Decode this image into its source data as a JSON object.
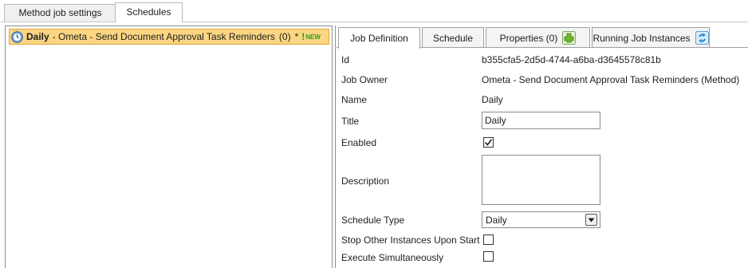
{
  "outer_tabs": [
    {
      "label": "Method job settings",
      "active": false
    },
    {
      "label": "Schedules",
      "active": true
    }
  ],
  "schedule_list": {
    "items": [
      {
        "icon": "schedule-clock-icon",
        "name": "Daily",
        "description": "- Ometa - Send Document Approval Task Reminders",
        "count": "(0)",
        "modified_marker": "*",
        "badge": {
          "icon": "new-exclamation-icon",
          "text": "NEW"
        },
        "selected": true
      }
    ]
  },
  "detail_tabs": [
    {
      "label": "Job Definition",
      "active": true
    },
    {
      "label": "Schedule",
      "active": false
    },
    {
      "label": "Properties (0)",
      "active": false,
      "icon": "add-property-icon"
    },
    {
      "label": "Running Job Instances",
      "active": false,
      "icon": "refresh-icon"
    }
  ],
  "job_definition": {
    "id_label": "Id",
    "id_value": "b355cfa5-2d5d-4744-a6ba-d3645578c81b",
    "owner_label": "Job Owner",
    "owner_value": "Ometa - Send Document Approval Task Reminders  (Method)",
    "name_label": "Name",
    "name_value": "Daily",
    "title_label": "Title",
    "title_value": "Daily",
    "enabled_label": "Enabled",
    "enabled": true,
    "description_label": "Description",
    "description_value": "",
    "schedule_type_label": "Schedule Type",
    "schedule_type_value": "Daily",
    "stop_other_label": "Stop Other Instances Upon Start",
    "stop_other": false,
    "execute_simul_label": "Execute Simultaneously",
    "execute_simul": false
  },
  "colors": {
    "selected_row": "#fbd583",
    "selected_row_border": "#e0a73c",
    "new_badge": "#2d9c1e",
    "add_icon": "#6fb52c",
    "refresh_icon": "#2a8fd0"
  }
}
